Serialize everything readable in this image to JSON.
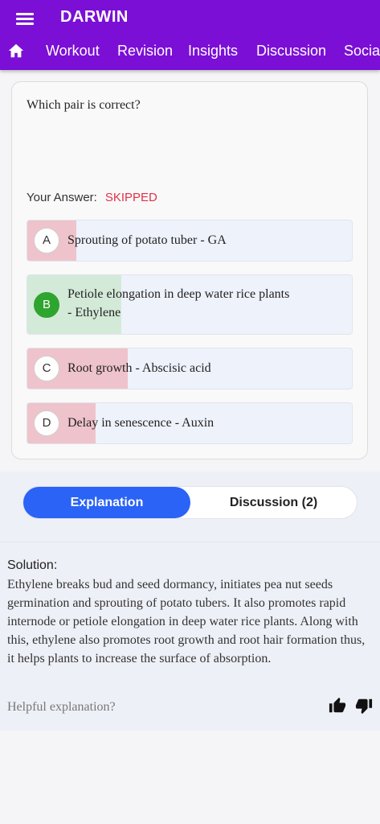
{
  "app": {
    "title": "DARWIN"
  },
  "nav": {
    "tabs": [
      "Workout",
      "Revision",
      "Insights",
      "Discussion",
      "Social"
    ]
  },
  "question": {
    "text": "Which pair is correct?"
  },
  "answer": {
    "label": "Your Answer:",
    "value": "SKIPPED"
  },
  "options": [
    {
      "key": "A",
      "line1": "Sprouting of potato tuber - GA",
      "line2": "",
      "percent": 15,
      "state": "wrong"
    },
    {
      "key": "B",
      "line1": "Petiole elongation in deep water rice plants",
      "line2": "- Ethylene",
      "percent": 29,
      "state": "correct"
    },
    {
      "key": "C",
      "line1": "Root growth -  Abscisic acid",
      "line2": "",
      "percent": 31,
      "state": "wrong"
    },
    {
      "key": "D",
      "line1": "Delay in senescence - Auxin",
      "line2": "",
      "percent": 21,
      "state": "wrong"
    }
  ],
  "tabs": {
    "explanation": "Explanation",
    "discussion": "Discussion (2)"
  },
  "solution": {
    "title": "Solution:",
    "text": "Ethylene breaks bud and seed dormancy, initiates pea nut seeds germination and sprouting of potato tubers. It also promotes rapid internode or petiole elongation in deep water rice plants. Along with this, ethylene also promotes root growth and root hair formation thus, it helps plants to increase the surface of absorption."
  },
  "feedback": {
    "prompt": "Helpful explanation?"
  },
  "colors": {
    "header": "#7b0fd6",
    "correct_fill": "#d4ead9",
    "wrong_fill": "#efc3cb",
    "accent": "#2a63f6",
    "skipped": "#e0314a"
  },
  "icons": {
    "menu": "menu-icon",
    "home": "home-icon",
    "like": "thumbs-up-icon",
    "dislike": "thumbs-down-icon"
  }
}
